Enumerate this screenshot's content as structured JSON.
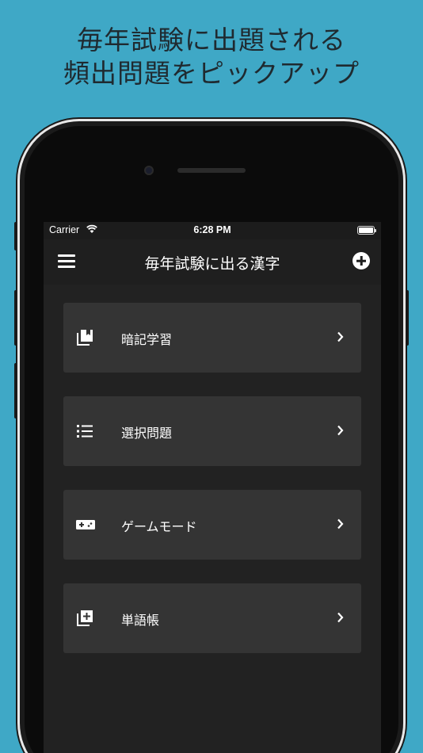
{
  "promo": {
    "line1": "毎年試験に出題される",
    "line2": "頻出問題をピックアップ"
  },
  "status_bar": {
    "carrier": "Carrier",
    "time": "6:28 PM"
  },
  "navbar": {
    "title": "毎年試験に出る漢字",
    "menu_icon": "hamburger-icon",
    "add_icon": "plus-circle-icon"
  },
  "menu": {
    "items": [
      {
        "label": "暗記学習",
        "icon": "bookmark-pages-icon"
      },
      {
        "label": "選択問題",
        "icon": "list-icon"
      },
      {
        "label": "ゲームモード",
        "icon": "gamepad-icon"
      },
      {
        "label": "単語帳",
        "icon": "add-to-library-icon"
      }
    ]
  },
  "colors": {
    "background": "#3fa8c6",
    "screen": "#222222",
    "card": "#343434",
    "navbar": "#1f1f1f",
    "text": "#ffffff"
  }
}
